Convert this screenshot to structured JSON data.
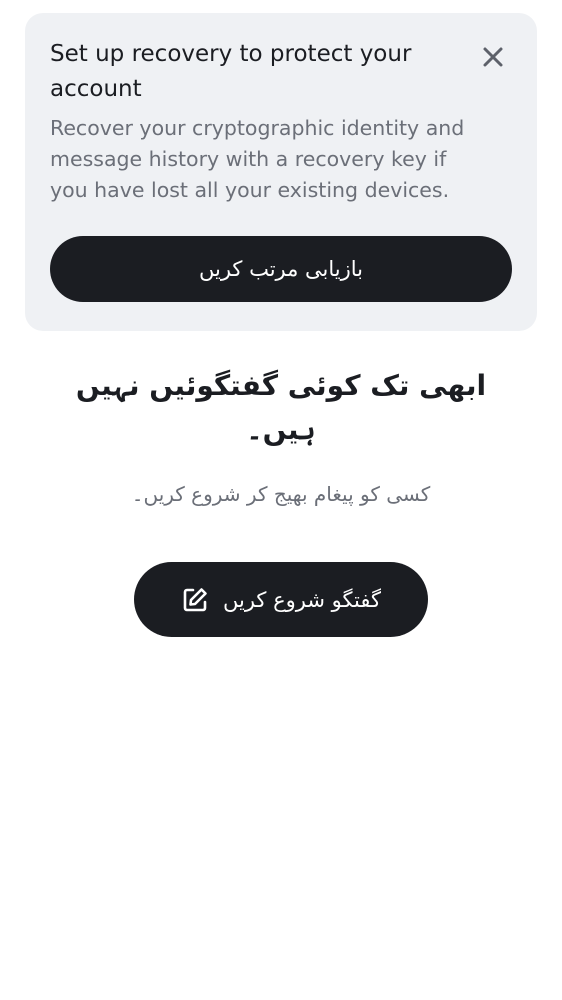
{
  "recovery_banner": {
    "title": "Set up recovery to protect your account",
    "description": "Recover your cryptographic identity and message history with a recovery key if you have lost all your existing devices.",
    "button_label": "بازیابی مرتب کریں",
    "close_icon": "close-icon"
  },
  "empty_state": {
    "heading": "ابھی تک کوئی گفتگوئیں نہیں ہیں۔",
    "subtitle": "کسی کو پیغام بھیج کر شروع کریں۔",
    "start_button_label": "گفتگو شروع کریں",
    "start_button_icon": "compose-icon"
  },
  "colors": {
    "banner_bg": "#eff1f4",
    "button_bg": "#1b1d22",
    "text_primary": "#1b1d22",
    "text_secondary": "#6b6f78"
  }
}
